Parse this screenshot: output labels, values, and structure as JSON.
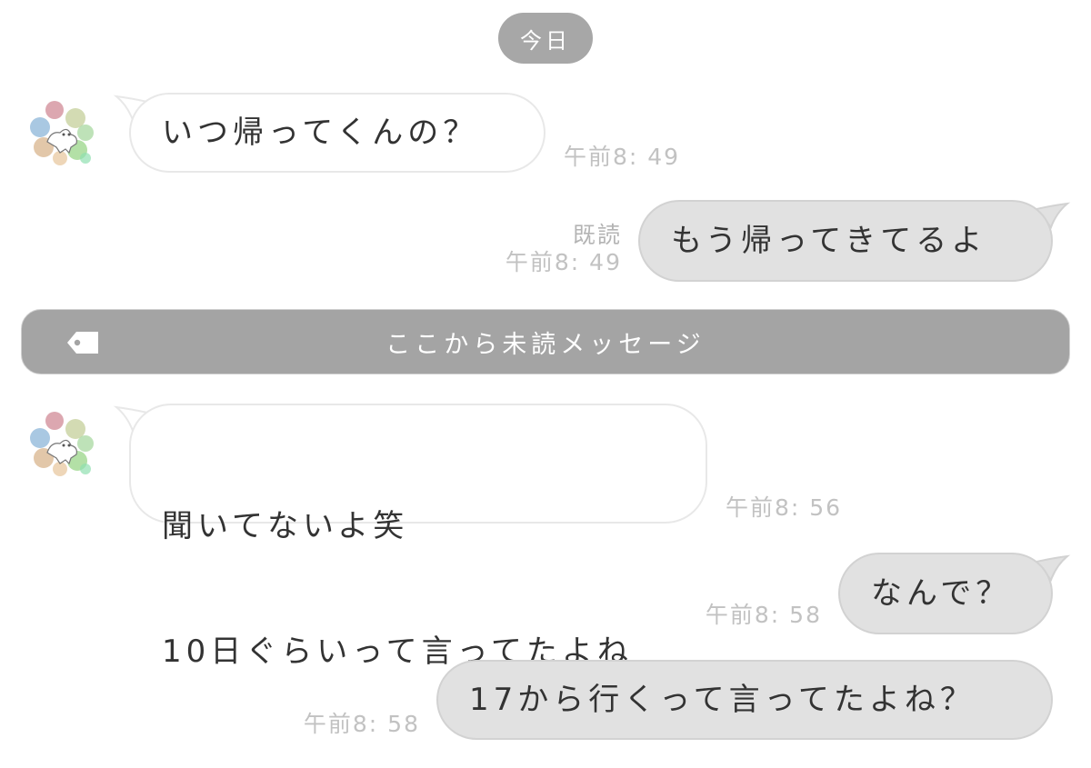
{
  "chat": {
    "date_label": "今日",
    "unread_divider": "ここから未読メッセージ",
    "messages": [
      {
        "side": "in",
        "text": "いつ帰ってくんの？",
        "time": "午前8: 49"
      },
      {
        "side": "out",
        "text": "もう帰ってきてるよ",
        "read": "既読",
        "time": "午前8: 49"
      },
      {
        "side": "in",
        "text_lines": [
          "聞いてないよ笑",
          "10日ぐらいって言ってたよね"
        ],
        "time": "午前8: 56"
      },
      {
        "side": "out",
        "text": "なんで？",
        "time": "午前8: 58"
      },
      {
        "side": "out",
        "text": "17から行くって言ってたよね？",
        "time": "午前8: 58"
      }
    ]
  },
  "icons": {
    "avatar": "avatar-icon",
    "tag": "tag-icon"
  },
  "colors": {
    "incoming_bubble": "#ffffff",
    "outgoing_bubble": "#e1e1e1",
    "date_pill": "#a7a7a7",
    "unread_bar": "#a4a4a4",
    "timestamp": "#c2c2c2"
  }
}
